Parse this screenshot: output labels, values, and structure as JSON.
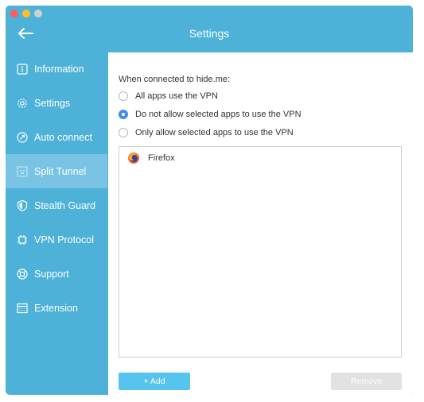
{
  "window": {
    "title": "Settings"
  },
  "sidebar": {
    "items": [
      {
        "label": "Information",
        "icon": "info-icon"
      },
      {
        "label": "Settings",
        "icon": "gear-icon"
      },
      {
        "label": "Auto connect",
        "icon": "auto-connect-icon"
      },
      {
        "label": "Split Tunnel",
        "icon": "split-tunnel-icon",
        "active": true
      },
      {
        "label": "Stealth Guard",
        "icon": "shield-icon"
      },
      {
        "label": "VPN Protocol",
        "icon": "protocol-icon"
      },
      {
        "label": "Support",
        "icon": "lifebuoy-icon"
      },
      {
        "label": "Extension",
        "icon": "window-icon"
      }
    ]
  },
  "split_tunnel": {
    "prompt": "When connected to hide.me:",
    "options": [
      {
        "label": "All apps use the VPN",
        "checked": false
      },
      {
        "label": "Do not allow selected apps to use the VPN",
        "checked": true
      },
      {
        "label": "Only allow selected apps to use the VPN",
        "checked": false
      }
    ],
    "apps": [
      {
        "name": "Firefox",
        "icon": "firefox-icon"
      }
    ],
    "add_label": "+ Add",
    "remove_label": "Remove"
  },
  "colors": {
    "accent": "#4db1d8",
    "active_item": "#79c4e4",
    "radio_checked": "#3f8cf3",
    "add_button": "#55c5ef",
    "remove_button_disabled": "#e2e2e2"
  }
}
